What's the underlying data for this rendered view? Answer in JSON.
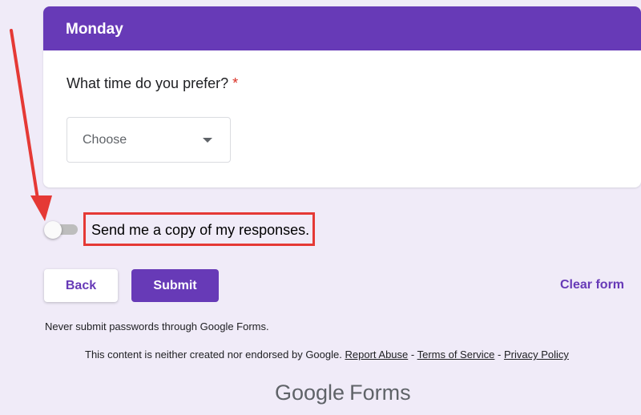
{
  "section": {
    "title": "Monday"
  },
  "question": {
    "text": "What time do you prefer?",
    "required_mark": "*",
    "select_value": "Choose"
  },
  "copy_toggle": {
    "label": "Send me a copy of my responses.",
    "state": "off"
  },
  "actions": {
    "back_label": "Back",
    "submit_label": "Submit",
    "clear_label": "Clear form"
  },
  "notice": "Never submit passwords through Google Forms.",
  "footer": {
    "disclaimer": "This content is neither created nor endorsed by Google.",
    "report_abuse": "Report Abuse",
    "sep1": " - ",
    "terms": "Terms of Service",
    "sep2": " - ",
    "privacy": "Privacy Policy"
  },
  "logo": {
    "google": "Google",
    "forms": "Forms"
  },
  "colors": {
    "accent": "#673ab7",
    "background": "#f0ebf8",
    "annotation": "#e53935",
    "required": "#d93025"
  },
  "icons": {
    "dropdown": "caret-down-icon",
    "annotation": "red-arrow-annotation"
  }
}
